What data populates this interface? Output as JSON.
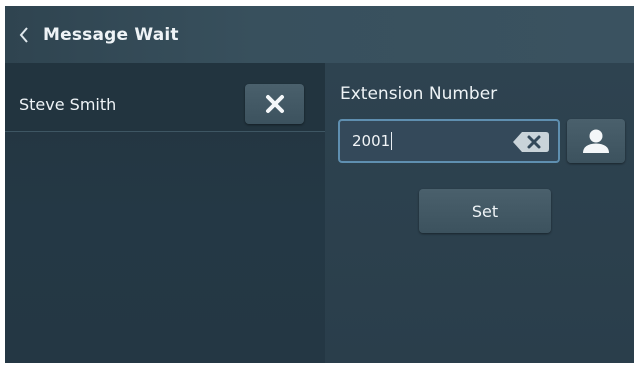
{
  "header": {
    "title": "Message Wait",
    "back_icon": "chevron-left-icon"
  },
  "contact": {
    "name": "Steve Smith",
    "remove_icon": "close-x-icon"
  },
  "extension": {
    "label": "Extension Number",
    "value": "2001",
    "clear_icon": "backspace-clear-icon",
    "contact_icon": "person-icon"
  },
  "actions": {
    "set_label": "Set"
  },
  "colors": {
    "header_bg": "#38505d",
    "pane_left": "#243845",
    "pane_right": "#2e4350",
    "button_bg": "#4a606c",
    "input_border": "#5f8fb0",
    "text": "#eef3f6"
  }
}
